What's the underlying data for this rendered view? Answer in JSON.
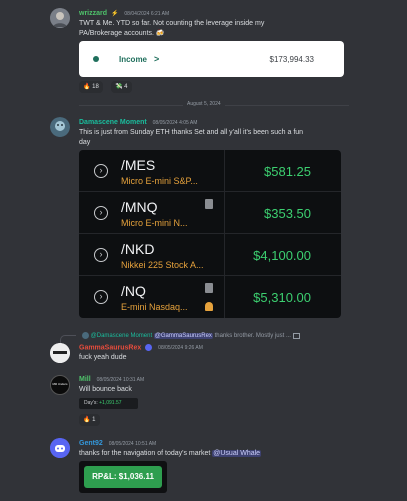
{
  "messages": {
    "m1": {
      "author": "wrizzard",
      "author_color": "#4fc36b",
      "badge": "⚡",
      "timestamp": "08/04/2024 6:21 AM",
      "text_line1": "TWT & Me. YTD so far. Not counting the leverage inside my",
      "text_line2": "PA/Brokerage accounts. 🍻",
      "card": {
        "label": "Income",
        "chevron": ">",
        "value": "$173,994.33"
      },
      "reactions": [
        {
          "emoji": "🔥",
          "count": "18"
        },
        {
          "emoji": "💸",
          "count": "4"
        }
      ]
    },
    "divider_label": "August 5, 2024",
    "m2": {
      "author": "Damascene Moment",
      "author_color": "#1abc9c",
      "timestamp": "08/05/2024 4:05 AM",
      "text_line1": "This is just from Sunday ETH thanks Set and all y'all it's been such a fun",
      "text_line2": "day",
      "tickers": [
        {
          "symbol": "/MES",
          "description": "Micro E-mini S&P...",
          "price": "$581.25"
        },
        {
          "symbol": "/MNQ",
          "description": "Micro E-mini N...",
          "price": "$353.50"
        },
        {
          "symbol": "/NKD",
          "description": "Nikkei 225 Stock A...",
          "price": "$4,100.00"
        },
        {
          "symbol": "/NQ",
          "description": "E-mini Nasdaq...",
          "price": "$5,310.00"
        }
      ]
    },
    "m3": {
      "reply_author": "@Damascene Moment",
      "reply_mention": "@GammaSaurusRex",
      "reply_text": "thanks brother. Mostly just ...",
      "author": "GammaSaurusRex",
      "author_color": "#e74c3c",
      "timestamp": "08/05/2024 9:26 AM",
      "text": "fuck yeah dude"
    },
    "m4": {
      "author": "Mill",
      "author_color": "#4fc36b",
      "avatar_text": "Mill Unders",
      "timestamp": "08/05/2024 10:31 AM",
      "text": "Will bounce back",
      "stat_label": "Day's:",
      "stat_value": "+1,091.57",
      "reactions": [
        {
          "emoji": "🔥",
          "count": "1"
        }
      ]
    },
    "m5": {
      "author": "Gent92",
      "author_color": "#3498db",
      "timestamp": "08/05/2024 10:51 AM",
      "text_before": "thanks for the navigation of today's market",
      "mention": "@Usual Whale",
      "pnl": "RP&L: $1,036.11"
    }
  }
}
